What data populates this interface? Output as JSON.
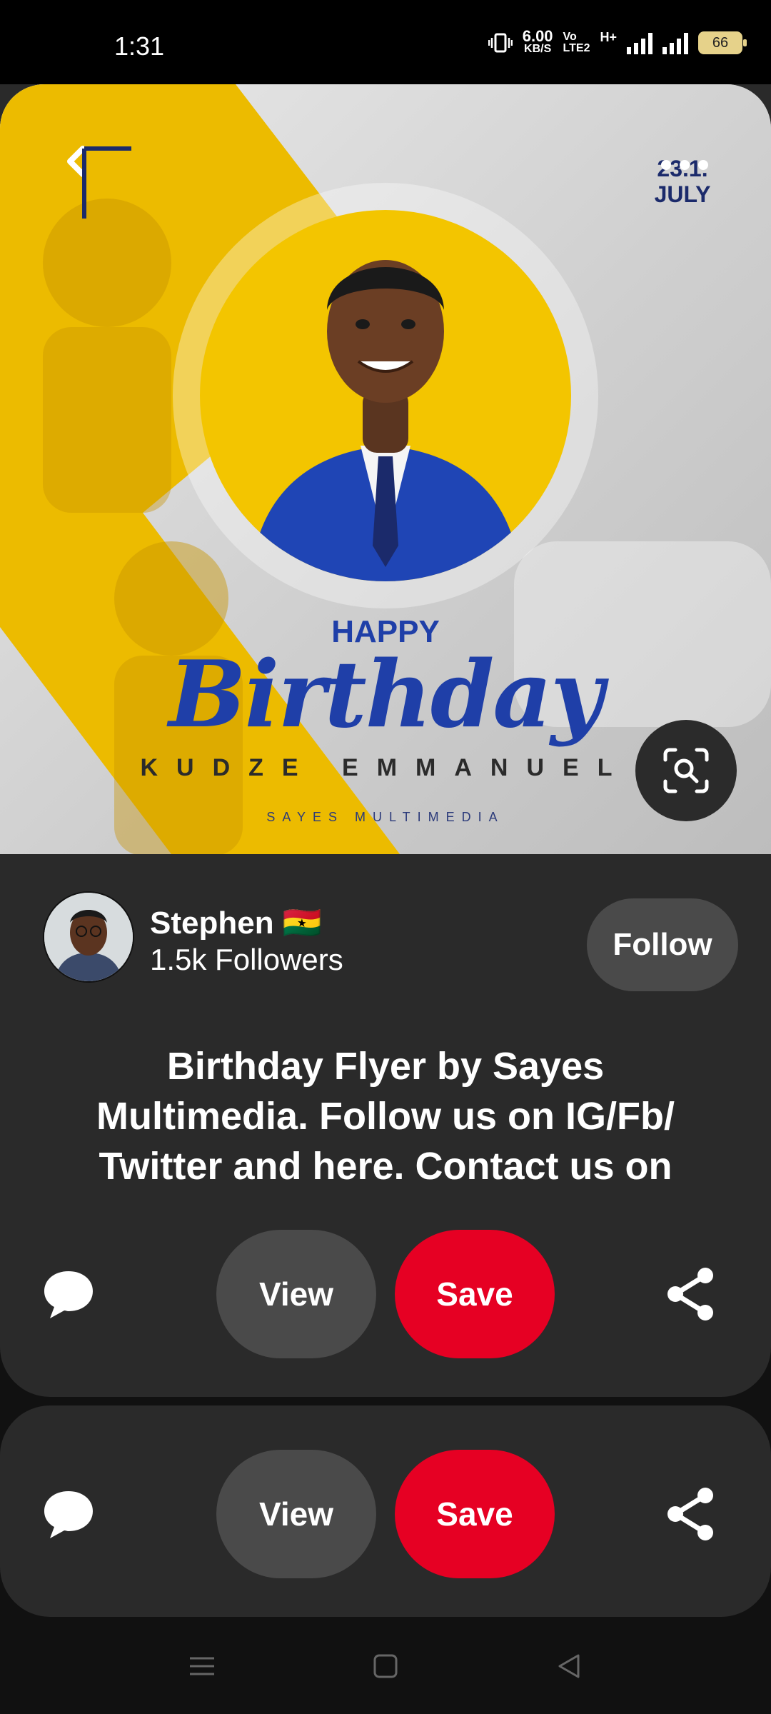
{
  "status_bar": {
    "time": "1:31",
    "net_speed_value": "6.00",
    "net_speed_unit": "KB/S",
    "volte_top": "Vo",
    "volte_bottom": "LTE2",
    "network_type": "H+",
    "battery": "66"
  },
  "pin": {
    "image_text": {
      "date_top": "23.1.",
      "date_month": "JULY",
      "happy": "HAPPY",
      "birthday": "Birthday",
      "name": "KUDZE EMMANUEL",
      "brand": "SAYES MULTIMEDIA"
    },
    "user": {
      "name": "Stephen 🇬🇭",
      "followers": "1.5k Followers",
      "follow_label": "Follow"
    },
    "description": "Birthday Flyer by Sayes Multimedia. Follow us on IG/Fb/ Twitter and here. Contact us on",
    "actions": {
      "view_label": "View",
      "save_label": "Save"
    }
  },
  "next_card": {
    "actions": {
      "view_label": "View",
      "save_label": "Save"
    }
  },
  "colors": {
    "save_red": "#e60023",
    "card_bg": "#2a2a2a",
    "yellow": "#f3c500",
    "blue_text": "#1f3fa8"
  },
  "icons": [
    "back-arrow-icon",
    "more-dots-icon",
    "visual-search-icon",
    "comment-icon",
    "share-icon",
    "menu-icon",
    "home-square-icon",
    "back-triangle-icon"
  ]
}
